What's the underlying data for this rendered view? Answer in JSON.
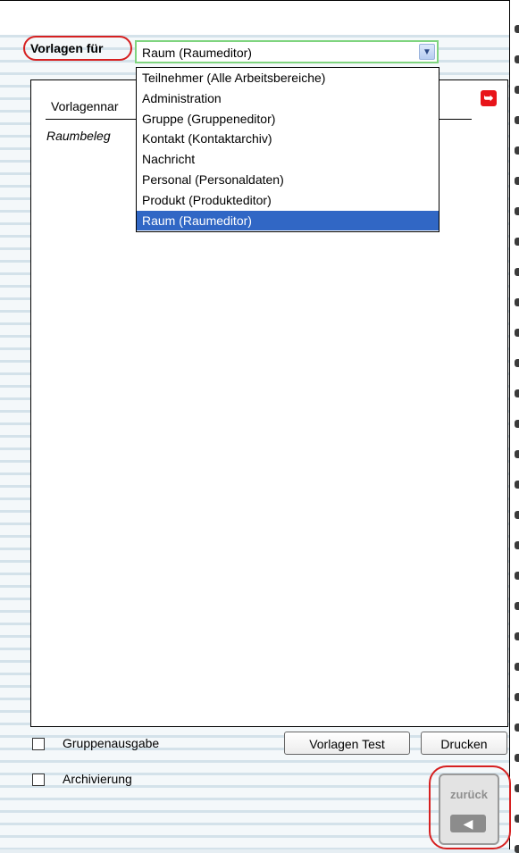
{
  "header": {
    "label": "Vorlagen für",
    "select_value": "Raum (Raumeditor)",
    "select_arrow_icon": "chevron-down-icon"
  },
  "dropdown": {
    "options": [
      "Teilnehmer (Alle Arbeitsbereiche)",
      "Administration",
      "Gruppe (Gruppeneditor)",
      "Kontakt (Kontaktarchiv)",
      "Nachricht",
      "Personal (Personaldaten)",
      "Produkt (Produkteditor)",
      "Raum (Raumeditor)"
    ],
    "selected_index": 7
  },
  "list": {
    "column_header": "Vorlagennar",
    "rows": [
      "Raumbeleg"
    ],
    "export_icon": "export-icon"
  },
  "footer": {
    "checkbox_gruppenausgabe": "Gruppenausgabe",
    "checkbox_archivierung": "Archivierung",
    "button_test": "Vorlagen Test",
    "button_print": "Drucken",
    "back_label": "zurück",
    "back_icon": "arrow-left-icon"
  },
  "colors": {
    "highlight_oval": "#d62020",
    "selected_option": "#3167c5",
    "select_border": "#7fd47f"
  }
}
